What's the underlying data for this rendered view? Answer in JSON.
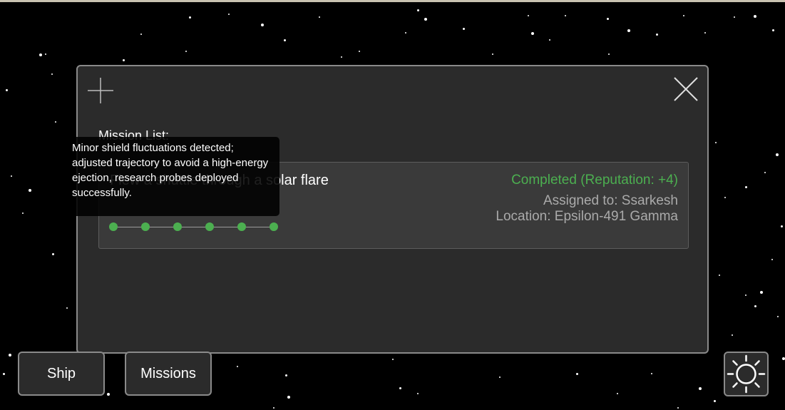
{
  "modal": {
    "add_icon": "plus-icon",
    "close_icon": "close-icon",
    "list_label": "Mission List:"
  },
  "mission": {
    "title": "Flew a shuttle through a solar flare",
    "status": "Completed (Reputation: +4)",
    "assigned": "Assigned to: Ssarkesh",
    "location": "Location: Epsilon-491 Gamma",
    "status_color": "#4caf50",
    "steps_total": 6,
    "steps_completed": 6
  },
  "tooltip": {
    "text": "Minor shield fluctuations detected; adjusted trajectory to avoid a high-energy ejection, research probes deployed successfully."
  },
  "nav": {
    "ship_label": "Ship",
    "missions_label": "Missions",
    "theme_icon": "sun-icon"
  }
}
